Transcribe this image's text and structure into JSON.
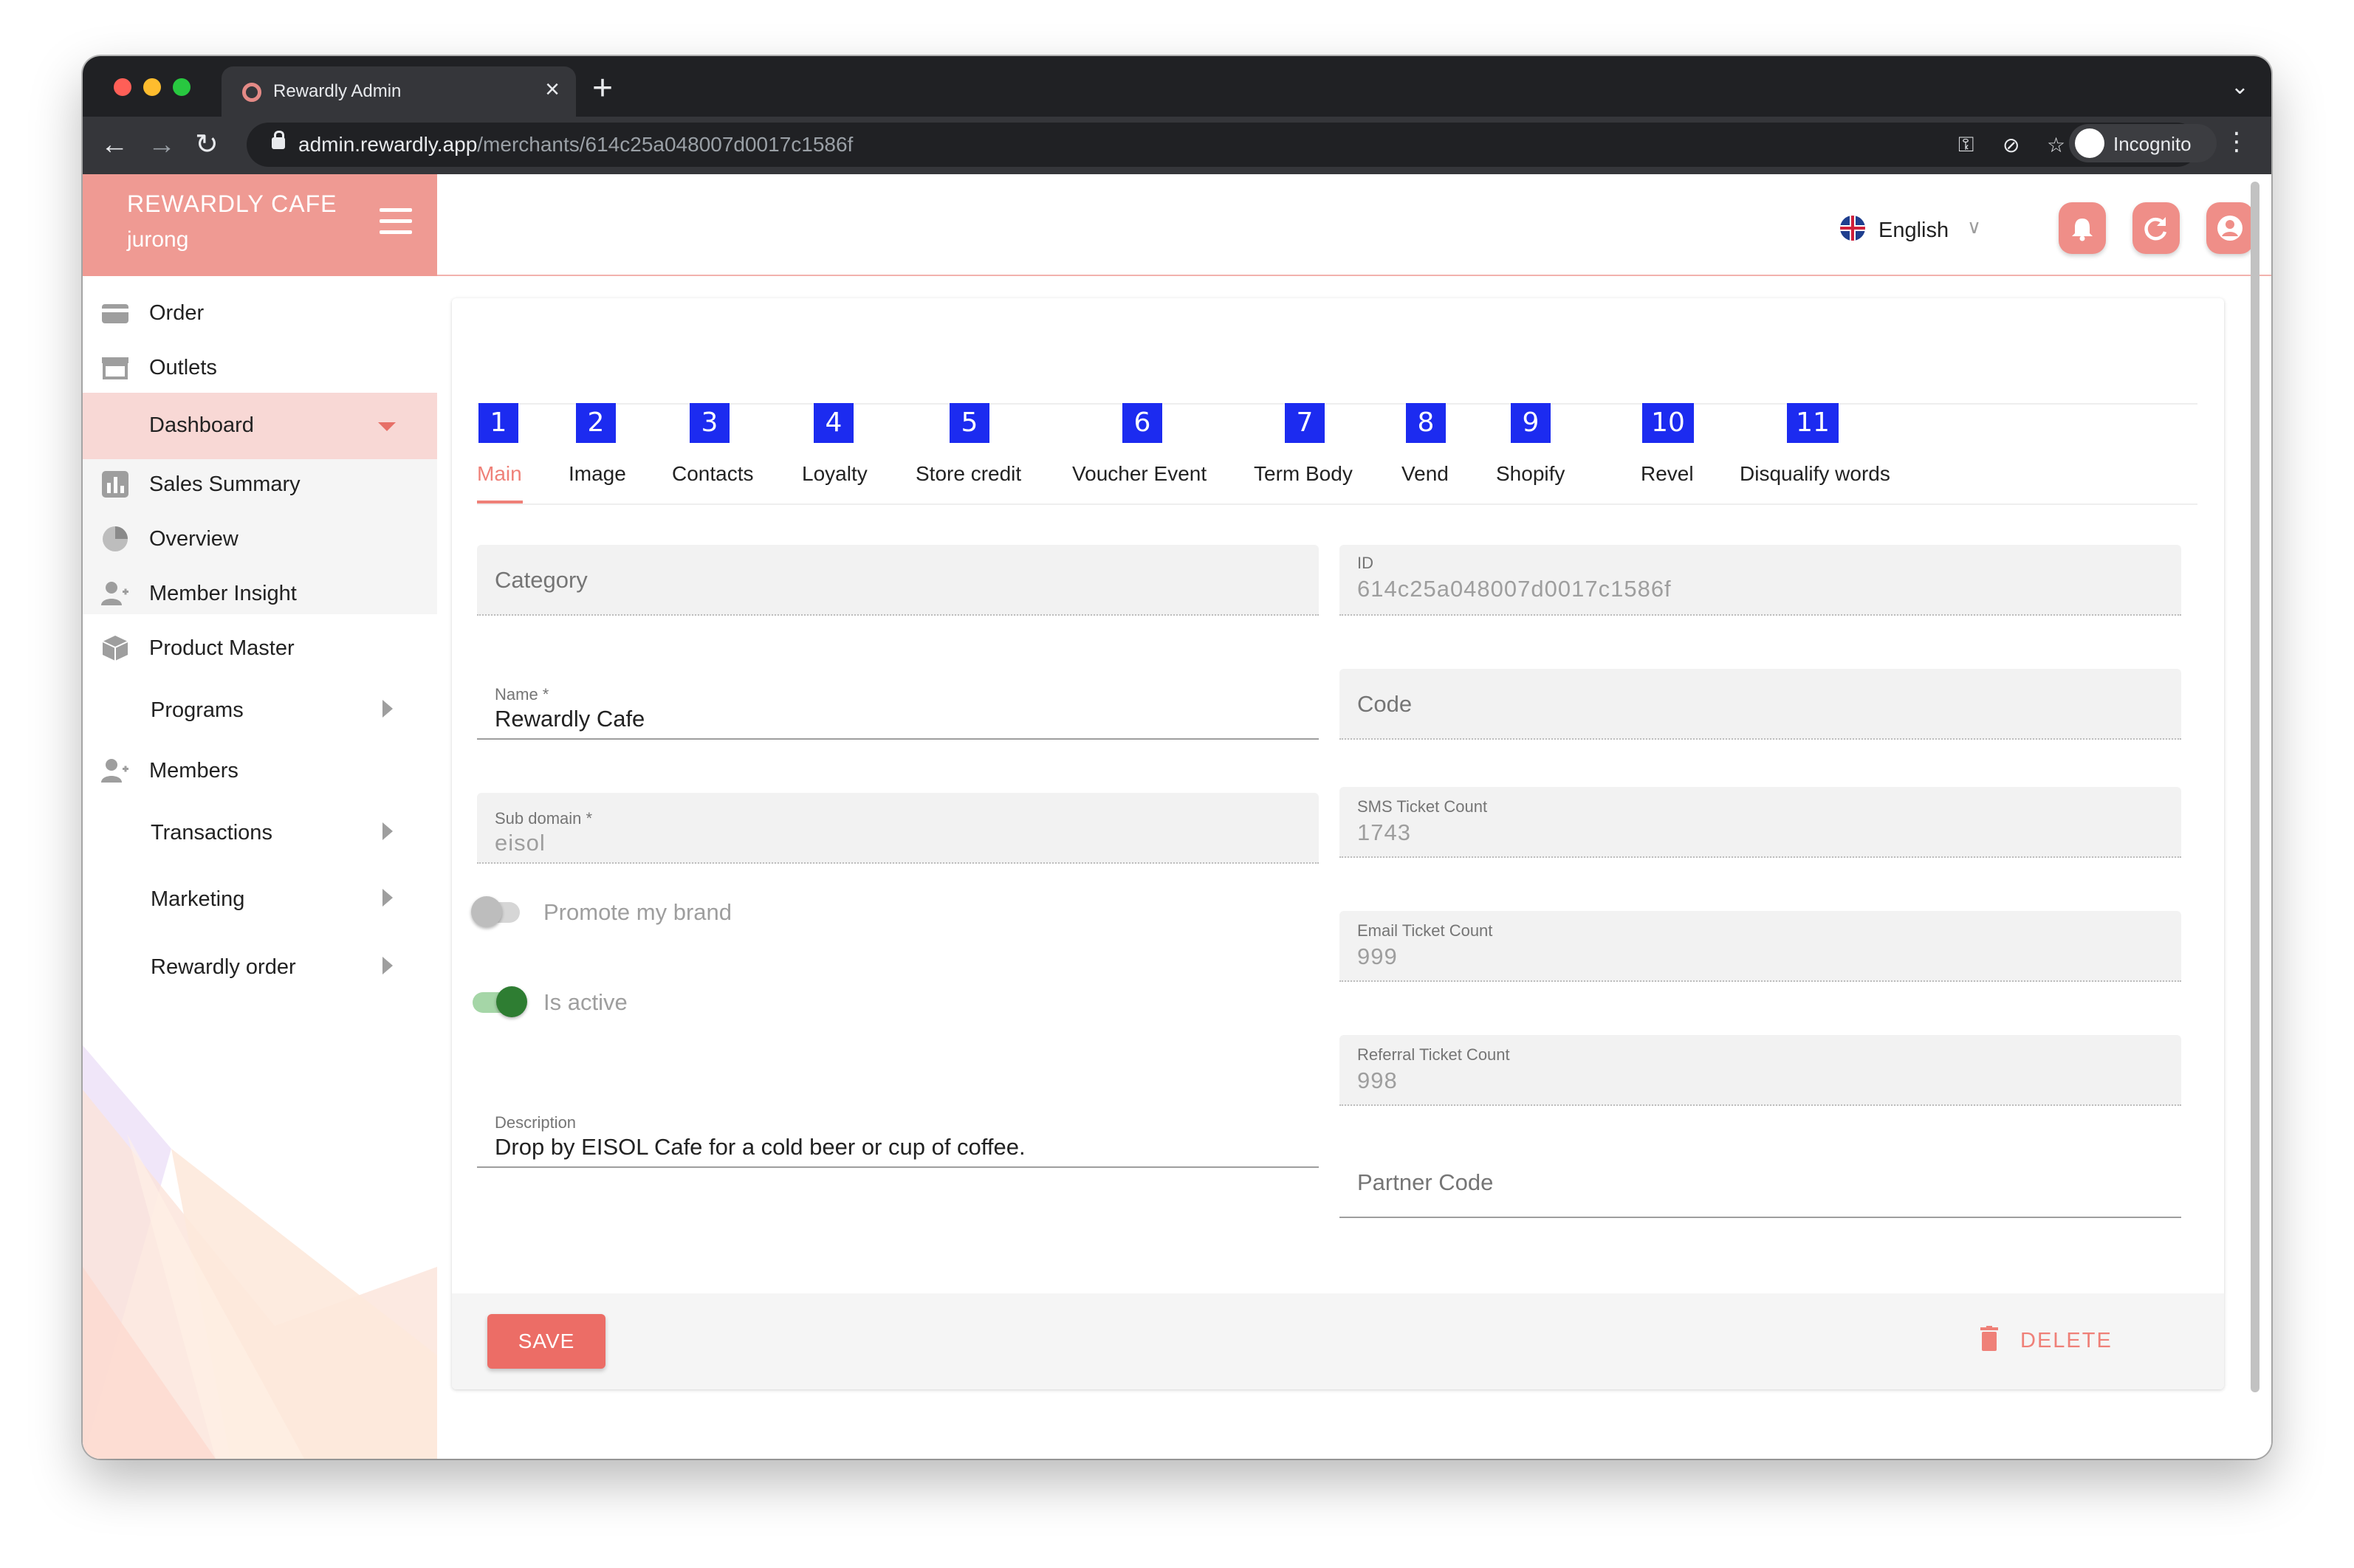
{
  "browser": {
    "tab_title": "Rewardly Admin",
    "tab_close": "×",
    "new_tab": "+",
    "url_host": "admin.rewardly.app",
    "url_path": "/merchants/614c25a048007d0017c1586f",
    "profile_label": "Incognito",
    "icons": [
      "back-arrow-icon",
      "forward-arrow-icon",
      "reload-icon",
      "lock-icon",
      "key-icon",
      "eye-off-icon",
      "star-icon",
      "sidebar-icon",
      "incognito-icon",
      "more-vert-icon"
    ]
  },
  "sidebar": {
    "brand_name": "REWARDLY CAFE",
    "brand_sub": "jurong",
    "items": [
      {
        "label": "Order",
        "icon": "card-icon"
      },
      {
        "label": "Outlets",
        "icon": "store-icon"
      },
      {
        "label": "Dashboard",
        "expanded": true
      },
      {
        "label": "Sales Summary",
        "icon": "bar-chart-icon"
      },
      {
        "label": "Overview",
        "icon": "pie-chart-icon"
      },
      {
        "label": "Member Insight",
        "icon": "person-add-icon"
      },
      {
        "label": "Product Master",
        "icon": "cube-icon"
      },
      {
        "label": "Programs",
        "submenu": true
      },
      {
        "label": "Members",
        "icon": "person-add-icon"
      },
      {
        "label": "Transactions",
        "submenu": true
      },
      {
        "label": "Marketing",
        "submenu": true
      },
      {
        "label": "Rewardly order",
        "submenu": true
      }
    ]
  },
  "header": {
    "language": "English",
    "language_chevron": "∨",
    "accent": "#ef8e88",
    "buttons": [
      "bell-icon",
      "refresh-icon",
      "account-icon"
    ]
  },
  "tabs": [
    {
      "num": "1",
      "label": "Main",
      "active": true
    },
    {
      "num": "2",
      "label": "Image"
    },
    {
      "num": "3",
      "label": "Contacts"
    },
    {
      "num": "4",
      "label": "Loyalty"
    },
    {
      "num": "5",
      "label": "Store credit"
    },
    {
      "num": "6",
      "label": "Voucher Event"
    },
    {
      "num": "7",
      "label": "Term Body"
    },
    {
      "num": "8",
      "label": "Vend"
    },
    {
      "num": "9",
      "label": "Shopify"
    },
    {
      "num": "10",
      "label": "Revel"
    },
    {
      "num": "11",
      "label": "Disqualify words"
    }
  ],
  "form": {
    "category": {
      "placeholder": "Category"
    },
    "id": {
      "label": "ID",
      "value": "614c25a048007d0017c1586f"
    },
    "name": {
      "label": "Name *",
      "value": "Rewardly Cafe"
    },
    "code": {
      "placeholder": "Code"
    },
    "subdomain": {
      "label": "Sub domain *",
      "value": "eisol"
    },
    "sms_ticket": {
      "label": "SMS Ticket Count",
      "value": "1743"
    },
    "promote": {
      "label": "Promote my brand",
      "on": false
    },
    "email_ticket": {
      "label": "Email Ticket Count",
      "value": "999"
    },
    "is_active": {
      "label": "Is active",
      "on": true
    },
    "referral_ticket": {
      "label": "Referral Ticket Count",
      "value": "998"
    },
    "description": {
      "label": "Description",
      "value": "Drop by EISOL Cafe for a cold beer or cup of coffee."
    },
    "partner_code": {
      "placeholder": "Partner Code"
    }
  },
  "actions": {
    "save": "SAVE",
    "delete": "DELETE"
  },
  "colors": {
    "brand": "#ef9a93",
    "tab_badge": "#1c2bf0",
    "switch_on": "#2e7d32"
  }
}
